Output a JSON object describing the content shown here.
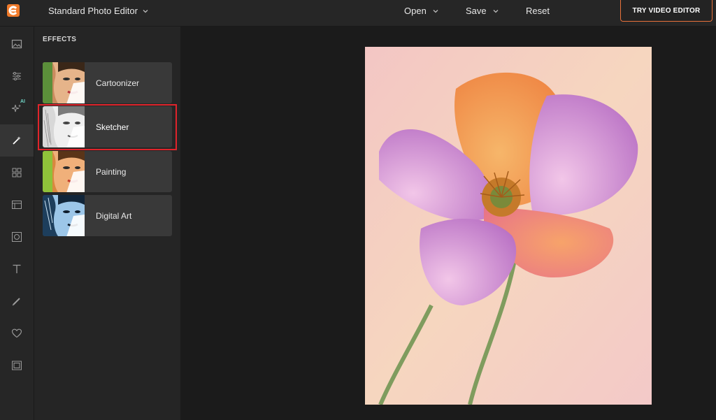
{
  "header": {
    "app_title": "Standard Photo Editor",
    "menu": [
      {
        "label": "Open"
      },
      {
        "label": "Save"
      },
      {
        "label": "Reset"
      }
    ],
    "try_button": "TRY VIDEO EDITOR"
  },
  "rail": {
    "ai_badge": "AI",
    "items": [
      {
        "icon": "image-icon"
      },
      {
        "icon": "adjustments-icon"
      },
      {
        "icon": "ai-sparkle-icon"
      },
      {
        "icon": "magic-wand-icon",
        "active": true
      },
      {
        "icon": "grid-icon"
      },
      {
        "icon": "overlay-icon"
      },
      {
        "icon": "frame-icon"
      },
      {
        "icon": "text-icon"
      },
      {
        "icon": "brush-icon"
      },
      {
        "icon": "heart-icon"
      },
      {
        "icon": "border-icon"
      }
    ]
  },
  "effects": {
    "title": "EFFECTS",
    "items": [
      {
        "label": "Cartoonizer"
      },
      {
        "label": "Sketcher",
        "selected": true
      },
      {
        "label": "Painting"
      },
      {
        "label": "Digital Art"
      }
    ]
  },
  "colors": {
    "accent": "#e8713a",
    "highlight": "#e0242b",
    "ai_badge": "#6fd3c4"
  }
}
